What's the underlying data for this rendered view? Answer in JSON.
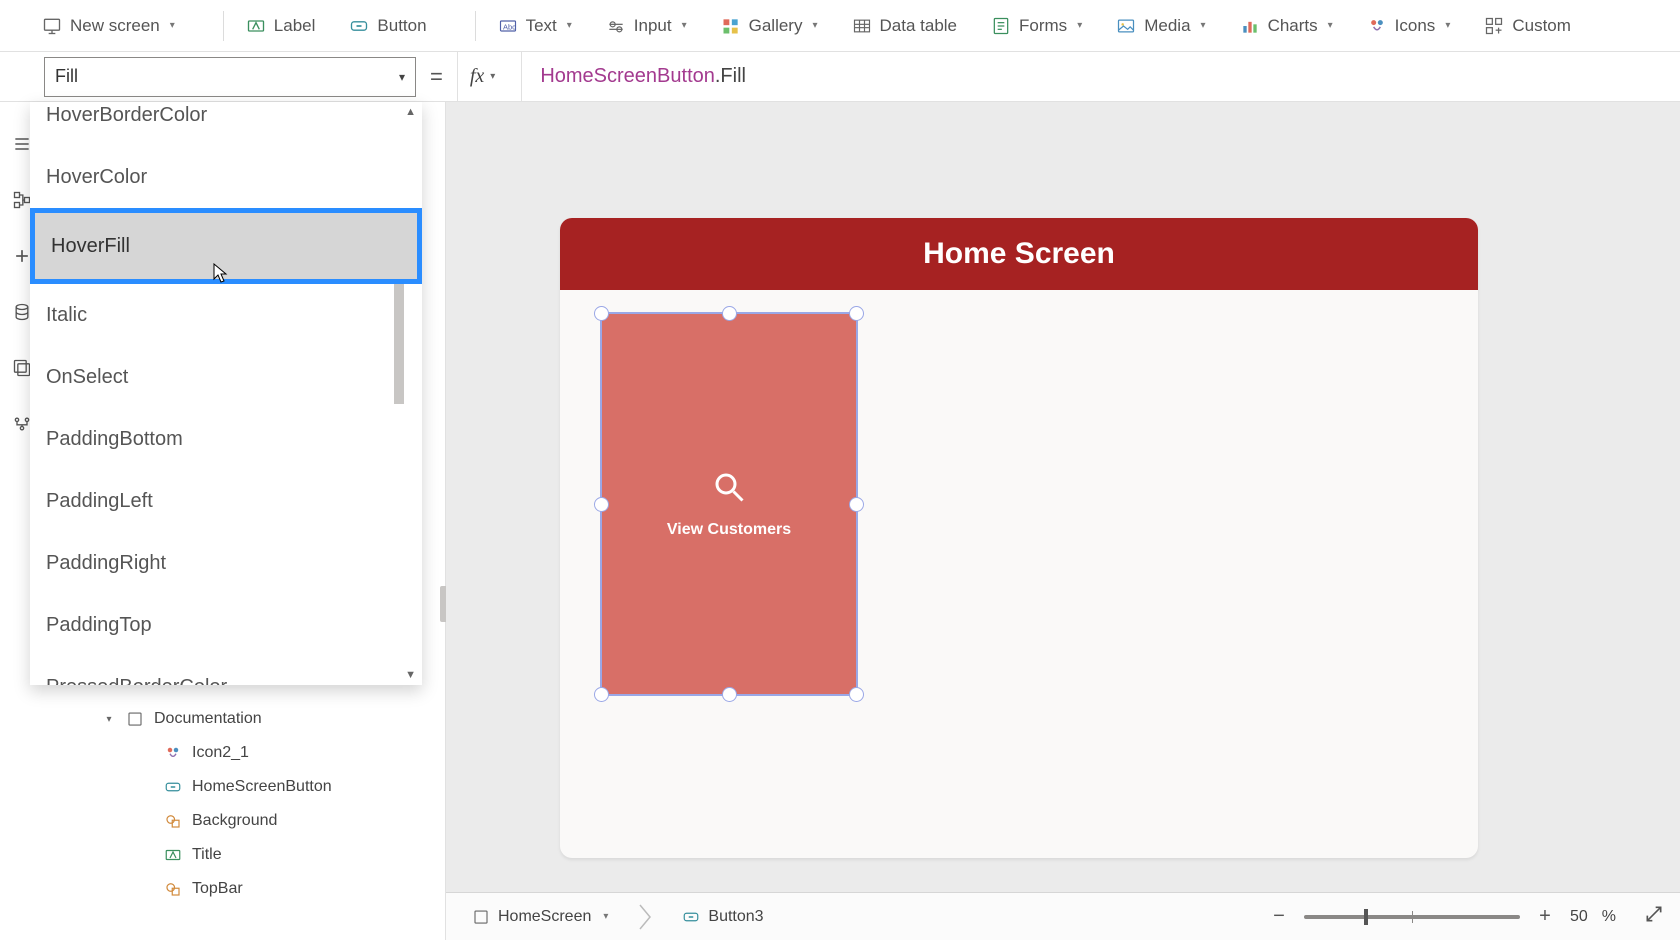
{
  "ribbon": {
    "new_screen": "New screen",
    "label": "Label",
    "button": "Button",
    "text": "Text",
    "input": "Input",
    "gallery": "Gallery",
    "data_table": "Data table",
    "forms": "Forms",
    "media": "Media",
    "charts": "Charts",
    "icons": "Icons",
    "custom": "Custom"
  },
  "formula": {
    "selected_property": "Fill",
    "ref": "HomeScreenButton",
    "prop": ".Fill"
  },
  "property_dropdown": {
    "items": [
      "HoverBorderColor",
      "HoverColor",
      "HoverFill",
      "Italic",
      "OnSelect",
      "PaddingBottom",
      "PaddingLeft",
      "PaddingRight",
      "PaddingTop",
      "PressedBorderColor"
    ],
    "highlighted_index": 2
  },
  "tree": {
    "folder": "Documentation",
    "children": [
      "Icon2_1",
      "HomeScreenButton",
      "Background",
      "Title",
      "TopBar"
    ]
  },
  "canvas": {
    "header_title": "Home Screen",
    "button_label": "View Customers"
  },
  "breadcrumb": {
    "screen": "HomeScreen",
    "selected": "Button3"
  },
  "zoom": {
    "value": "50",
    "suffix": "%"
  },
  "colors": {
    "header_red": "#a62222",
    "button_coral": "#d86f67",
    "highlight_blue": "#2a8dff"
  }
}
